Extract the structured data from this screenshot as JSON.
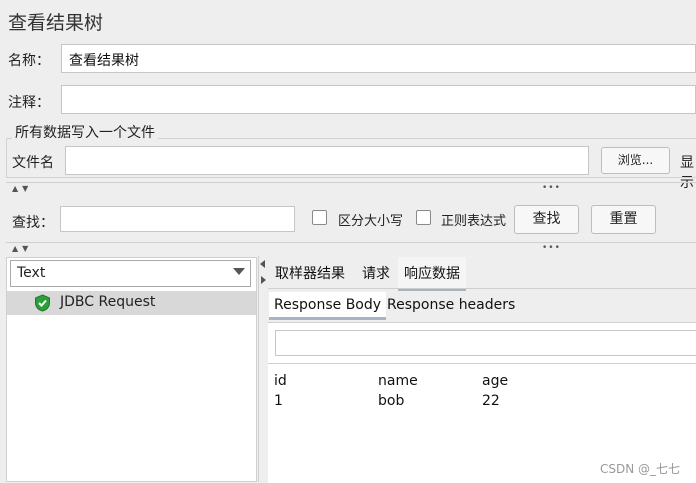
{
  "title": "查看结果树",
  "form": {
    "name_label": "名称：",
    "name_value": "查看结果树",
    "comment_label": "注释：",
    "group_title": "所有数据写入一个文件",
    "filename_label": "文件名",
    "browse_button": "浏览...",
    "display_partial": "显示"
  },
  "search": {
    "label": "查找：",
    "case_label": "区分大小写",
    "regex_label": "正则表达式",
    "find_button": "查找",
    "reset_button": "重置"
  },
  "left": {
    "renderer_selected": "Text",
    "tree_items": [
      "JDBC Request"
    ]
  },
  "tabs": [
    "取样器结果",
    "请求",
    "响应数据"
  ],
  "subtabs": [
    "Response Body",
    "Response headers"
  ],
  "table": {
    "headers": [
      "id",
      "name",
      "age"
    ],
    "rows": [
      [
        "1",
        "bob",
        "22"
      ]
    ]
  },
  "watermark": "CSDN @_七七",
  "colors": {
    "selected_tab_underline": "#a7b4c3",
    "success_icon": "#2e9e3a"
  }
}
